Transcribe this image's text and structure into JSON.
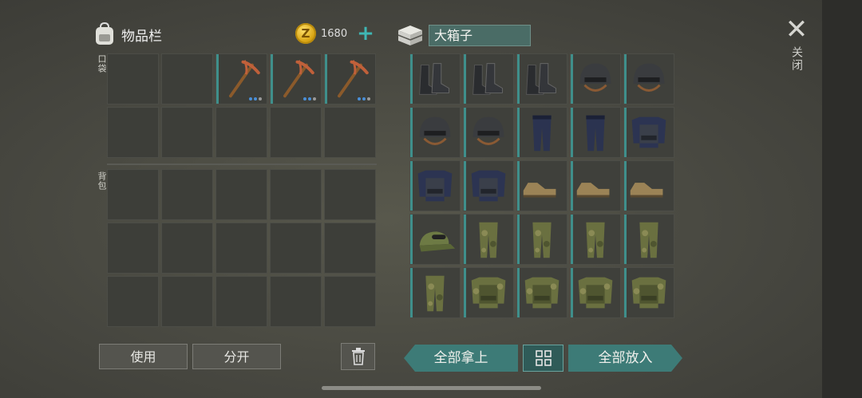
{
  "inventory": {
    "title": "物品栏",
    "coin_symbol": "Z",
    "currency": "1680",
    "add_icon": "+",
    "pocket_label": "口袋",
    "backpack_label": "背包",
    "pocket_slots": [
      "",
      "",
      "pickaxe",
      "pickaxe",
      "pickaxe",
      "",
      "",
      "",
      "",
      ""
    ],
    "backpack_slots": [
      "",
      "",
      "",
      "",
      "",
      "",
      "",
      "",
      "",
      "",
      "",
      "",
      "",
      "",
      ""
    ]
  },
  "box": {
    "name": "大箱子",
    "slots": [
      "boots",
      "boots",
      "boots",
      "helmet",
      "helmet",
      "helmet",
      "helmet",
      "police-pants",
      "police-pants",
      "police-vest",
      "police-vest",
      "police-vest",
      "shoes",
      "shoes",
      "shoes",
      "cap",
      "camo-pants",
      "camo-pants",
      "camo-pants",
      "camo-pants",
      "camo-pants",
      "camo-vest",
      "camo-vest",
      "camo-vest",
      "camo-vest"
    ]
  },
  "close": {
    "icon": "✕",
    "label": "关闭"
  },
  "actions": {
    "use": "使用",
    "split": "分开",
    "take_all": "全部拿上",
    "put_all": "全部放入"
  },
  "colors": {
    "accent": "#3d7b77",
    "box_name_bg": "#4a6c66",
    "coin": "#d9a514",
    "stack_dot": "#4a8fd8"
  }
}
